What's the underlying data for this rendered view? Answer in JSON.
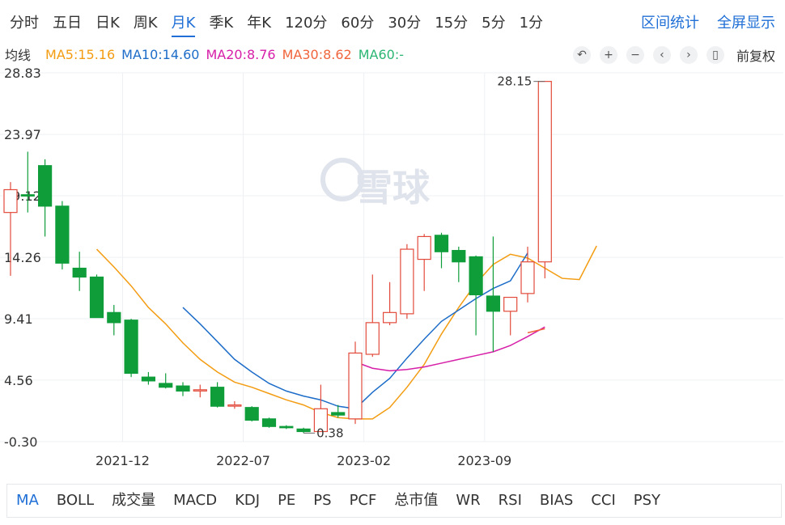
{
  "period_tabs": [
    "分时",
    "五日",
    "日K",
    "周K",
    "月K",
    "季K",
    "年K",
    "120分",
    "60分",
    "30分",
    "15分",
    "5分",
    "1分"
  ],
  "active_period": "月K",
  "right_links": [
    "区间统计",
    "全屏显示"
  ],
  "ma_legend": {
    "title": "均线",
    "items": [
      {
        "label": "MA5:15.16",
        "color": "#f39c12"
      },
      {
        "label": "MA10:14.60",
        "color": "#1c6cc8"
      },
      {
        "label": "MA20:8.76",
        "color": "#d61ea8"
      },
      {
        "label": "MA30:8.62",
        "color": "#f0643c"
      },
      {
        "label": "MA60:-",
        "color": "#2bb673"
      }
    ]
  },
  "toolbar": {
    "icons": [
      "undo-icon",
      "zoom-in-icon",
      "zoom-out-icon",
      "scroll-left-icon",
      "scroll-right-icon",
      "candle-icon"
    ],
    "adjust_label": "前复权"
  },
  "bottom_tabs": [
    "MA",
    "BOLL",
    "成交量",
    "MACD",
    "KDJ",
    "PE",
    "PS",
    "PCF",
    "总市值",
    "WR",
    "RSI",
    "BIAS",
    "CCI",
    "PSY"
  ],
  "active_indicator": "MA",
  "watermark": "雪球",
  "chart_data": {
    "type": "candlestick",
    "y_ticks": [
      "28.83",
      "23.97",
      "19.12",
      "14.26",
      "9.41",
      "4.56",
      "-0.30"
    ],
    "ylim": [
      -0.3,
      28.83
    ],
    "x_ticks": [
      {
        "index": 6.5,
        "label": "2021-12"
      },
      {
        "index": 13.5,
        "label": "2022-07"
      },
      {
        "index": 20.5,
        "label": "2023-02"
      },
      {
        "index": 27.5,
        "label": "2023-09"
      }
    ],
    "max_label": "28.15",
    "min_label": "0.38",
    "colors": {
      "up": "#e24b3b",
      "down": "#0f9d3a"
    },
    "candles": [
      {
        "o": 17.8,
        "c": 19.6,
        "h": 20.2,
        "l": 12.8
      },
      {
        "o": 19.2,
        "c": 19.1,
        "h": 22.6,
        "l": 17.8
      },
      {
        "o": 21.5,
        "c": 18.3,
        "h": 22.0,
        "l": 15.9
      },
      {
        "o": 18.3,
        "c": 13.8,
        "h": 18.7,
        "l": 13.3
      },
      {
        "o": 13.4,
        "c": 12.7,
        "h": 14.7,
        "l": 11.6
      },
      {
        "o": 12.7,
        "c": 9.5,
        "h": 12.9,
        "l": 9.5
      },
      {
        "o": 9.9,
        "c": 9.1,
        "h": 10.5,
        "l": 8.1
      },
      {
        "o": 9.3,
        "c": 5.1,
        "h": 9.4,
        "l": 4.8
      },
      {
        "o": 4.8,
        "c": 4.5,
        "h": 5.2,
        "l": 4.2
      },
      {
        "o": 4.3,
        "c": 4.0,
        "h": 5.1,
        "l": 3.9
      },
      {
        "o": 4.1,
        "c": 3.7,
        "h": 4.4,
        "l": 3.3
      },
      {
        "o": 3.8,
        "c": 3.8,
        "h": 4.2,
        "l": 3.2
      },
      {
        "o": 4.0,
        "c": 2.5,
        "h": 4.4,
        "l": 2.4
      },
      {
        "o": 2.6,
        "c": 2.6,
        "h": 2.9,
        "l": 2.3
      },
      {
        "o": 2.4,
        "c": 1.4,
        "h": 2.5,
        "l": 1.3
      },
      {
        "o": 1.5,
        "c": 0.9,
        "h": 1.6,
        "l": 0.8
      },
      {
        "o": 0.9,
        "c": 0.8,
        "h": 1.0,
        "l": 0.7
      },
      {
        "o": 0.7,
        "c": 0.5,
        "h": 0.8,
        "l": 0.38
      },
      {
        "o": 0.5,
        "c": 2.3,
        "h": 4.2,
        "l": 0.5
      },
      {
        "o": 2.0,
        "c": 1.8,
        "h": 2.6,
        "l": 1.6
      },
      {
        "o": 1.5,
        "c": 6.7,
        "h": 7.6,
        "l": 1.1
      },
      {
        "o": 6.6,
        "c": 9.1,
        "h": 12.9,
        "l": 6.4
      },
      {
        "o": 9.1,
        "c": 9.9,
        "h": 12.3,
        "l": 8.9
      },
      {
        "o": 9.8,
        "c": 14.9,
        "h": 15.3,
        "l": 9.4
      },
      {
        "o": 14.1,
        "c": 15.9,
        "h": 16.1,
        "l": 11.6
      },
      {
        "o": 16.0,
        "c": 14.7,
        "h": 16.2,
        "l": 13.4
      },
      {
        "o": 14.8,
        "c": 13.9,
        "h": 15.1,
        "l": 12.3
      },
      {
        "o": 14.3,
        "c": 11.3,
        "h": 14.4,
        "l": 8.1
      },
      {
        "o": 11.2,
        "c": 10.0,
        "h": 15.9,
        "l": 6.8
      },
      {
        "o": 10.0,
        "c": 11.1,
        "h": 11.1,
        "l": 8.1
      },
      {
        "o": 11.4,
        "c": 13.9,
        "h": 15.1,
        "l": 10.7
      },
      {
        "o": 13.9,
        "c": 28.15,
        "h": 28.15,
        "l": 12.6
      }
    ],
    "series": [
      {
        "name": "MA5",
        "color": "#f39c12",
        "start": 5,
        "values": [
          14.9,
          13.5,
          12.0,
          10.3,
          9.0,
          7.5,
          6.2,
          5.2,
          4.4,
          4.0,
          3.5,
          3.0,
          2.6,
          2.0,
          1.6,
          1.5,
          1.5,
          2.4,
          4.0,
          5.8,
          8.2,
          10.3,
          12.2,
          13.7,
          14.5,
          14.2,
          13.4,
          12.6,
          12.5,
          15.16
        ]
      },
      {
        "name": "MA10",
        "color": "#1c6cc8",
        "start": 10,
        "values": [
          10.3,
          9.0,
          7.6,
          6.2,
          5.2,
          4.3,
          3.7,
          3.3,
          3.0,
          2.5,
          2.3,
          3.6,
          4.7,
          6.3,
          7.8,
          9.2,
          10.1,
          11.0,
          11.8,
          12.4,
          14.6
        ]
      },
      {
        "name": "MA20",
        "color": "#d61ea8",
        "start": 20,
        "values": [
          6.0,
          5.5,
          5.3,
          5.4,
          5.6,
          5.9,
          6.2,
          6.5,
          6.8,
          7.3,
          8.0,
          8.76
        ]
      },
      {
        "name": "MA30",
        "color": "#f0643c",
        "start": 30,
        "values": [
          8.3,
          8.62
        ]
      }
    ]
  }
}
